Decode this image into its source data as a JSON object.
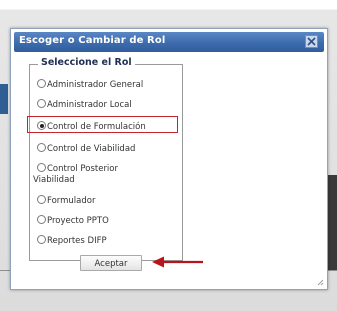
{
  "dialog": {
    "title": "Escoger o Cambiar de Rol",
    "close_icon": "close-icon"
  },
  "role_selector": {
    "legend": "Seleccione el Rol",
    "options": [
      {
        "label": "Administrador General",
        "checked": false
      },
      {
        "label": "Administrador Local",
        "checked": false
      },
      {
        "label": "Control de Formulación",
        "checked": true
      },
      {
        "label": "Control de Viabilidad",
        "checked": false
      },
      {
        "label": "Control Posterior",
        "label_line2": "Viabilidad",
        "checked": false
      },
      {
        "label": "Formulador",
        "checked": false
      },
      {
        "label": "Proyecto PPTO",
        "checked": false
      },
      {
        "label": "Reportes DIFP",
        "checked": false
      }
    ]
  },
  "actions": {
    "accept_label": "Aceptar"
  },
  "colors": {
    "titlebar": "#3d6cad",
    "highlight": "#c0282d",
    "arrow": "#b8141b"
  }
}
